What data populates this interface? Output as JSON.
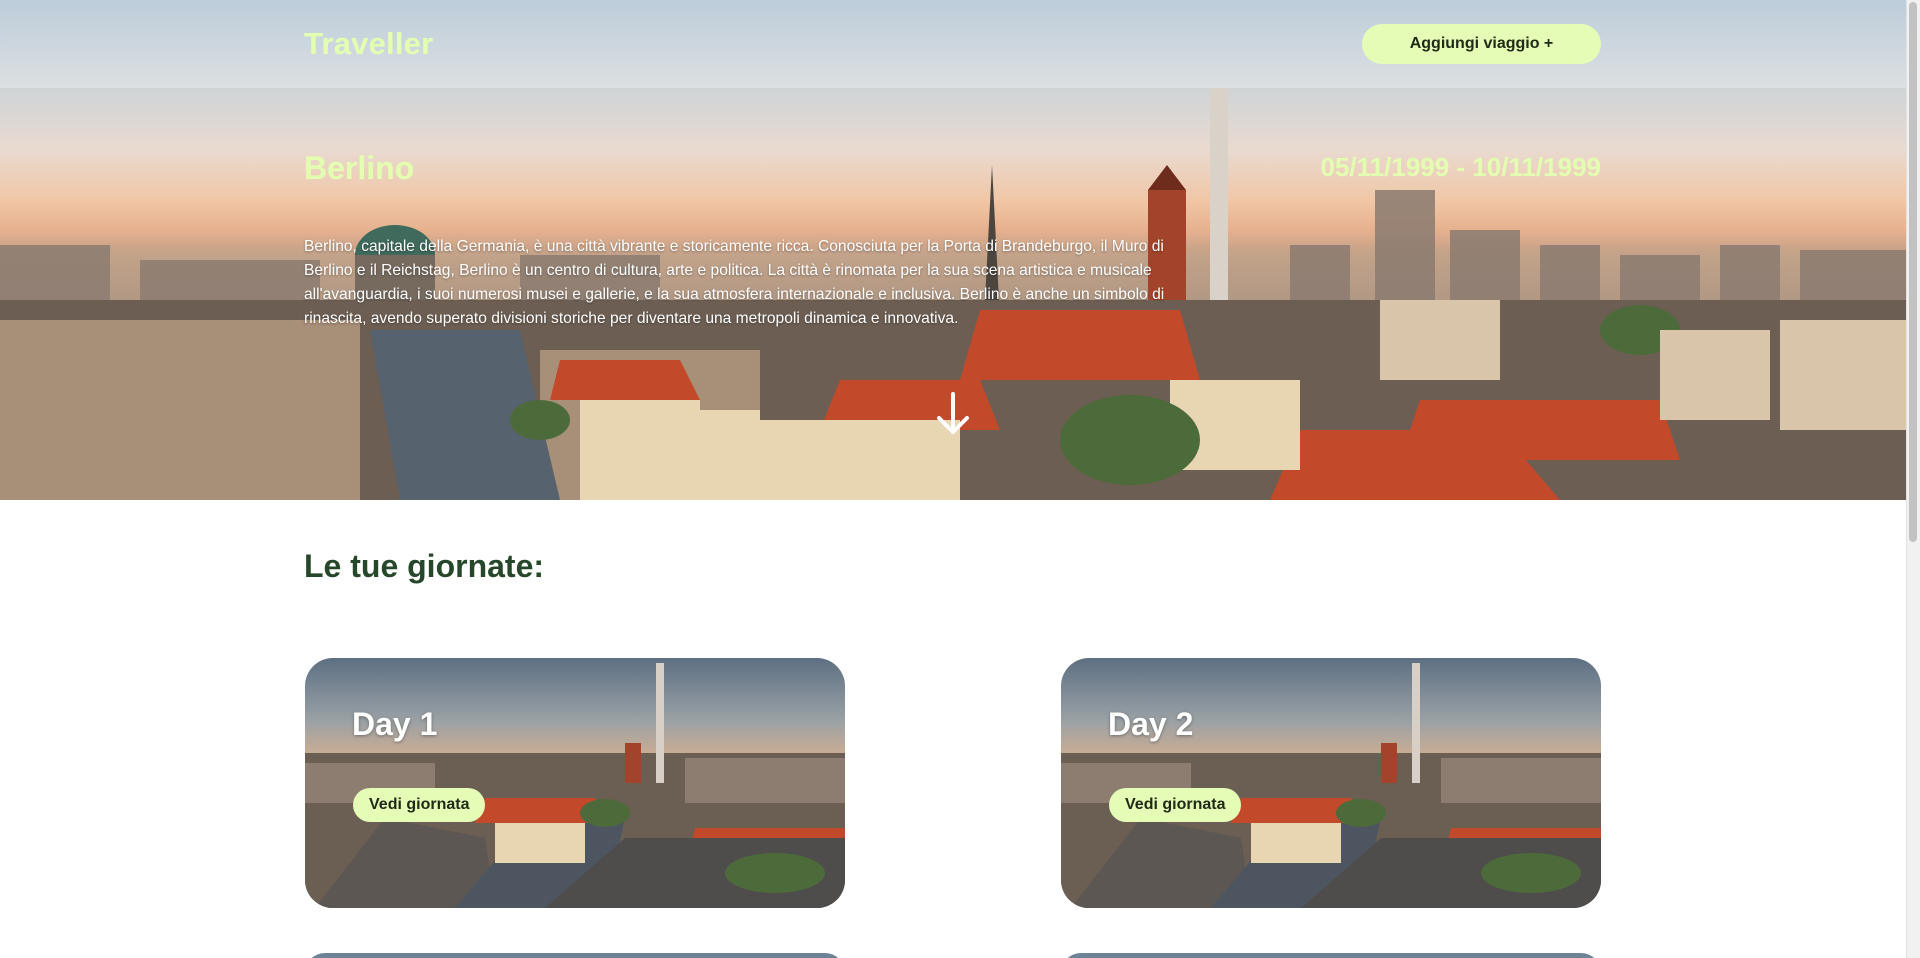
{
  "header": {
    "brand": "Traveller",
    "add_trip_label": "Aggiungi viaggio +"
  },
  "trip": {
    "city": "Berlino",
    "dates": "05/11/1999 - 10/11/1999",
    "description": "Berlino, capitale della Germania, è una città vibrante e storicamente ricca. Conosciuta per la Porta di Brandeburgo, il Muro di Berlino e il Reichstag, Berlino è un centro di cultura, arte e politica. La città è rinomata per la sua scena artistica e musicale all'avanguardia, i suoi numerosi musei e gallerie, e la sua atmosfera internazionale e inclusiva. Berlino è anche un simbolo di rinascita, avendo superato divisioni storiche per diventare una metropoli dinamica e innovativa.",
    "scroll_icon": "arrow-down-icon"
  },
  "days_section": {
    "title": "Le tue giornate:",
    "days": [
      {
        "label": "Day 1",
        "button_label": "Vedi giornata"
      },
      {
        "label": "Day 2",
        "button_label": "Vedi giornata"
      }
    ]
  },
  "colors": {
    "accent": "#e5fcb6",
    "heading_green": "#27472a",
    "hero_text": "#e3ffb0"
  }
}
